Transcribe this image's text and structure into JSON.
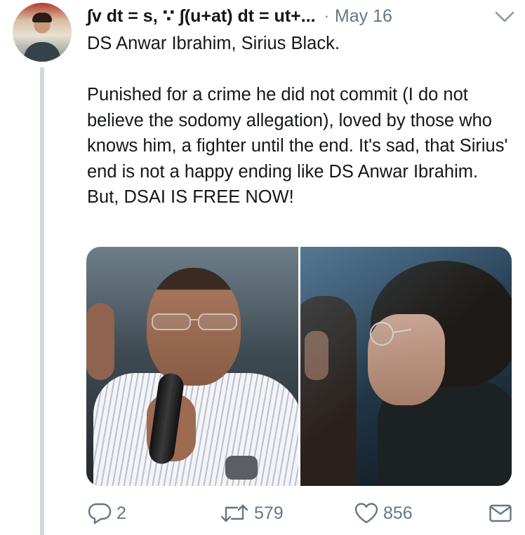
{
  "author": {
    "display_name": "∫v dt = s, ∵ ∫(u+at) dt = ut+...",
    "separator": "·",
    "date": "May 16"
  },
  "tweet": {
    "text": "DS Anwar Ibrahim, Sirius Black.\n\nPunished for a crime he did not commit (I do not believe the sodomy allegation), loved by those who knows him, a fighter until the end. It's sad, that Sirius' end is not a happy ending like DS Anwar Ibrahim. But, DSAI IS FREE NOW!"
  },
  "media": {
    "left_photo": "man-speaking-into-microphone",
    "right_photo": "movie-still-two-figures"
  },
  "actions": {
    "reply_count": "2",
    "retweet_count": "579",
    "like_count": "856"
  },
  "icons": {
    "reply": "reply-icon",
    "retweet": "retweet-icon",
    "like": "heart-icon",
    "direct_message": "mail-icon",
    "more": "chevron-down-icon"
  },
  "colors": {
    "text": "#14171a",
    "secondary_text": "#657786",
    "thread_line": "#cfd9de"
  }
}
